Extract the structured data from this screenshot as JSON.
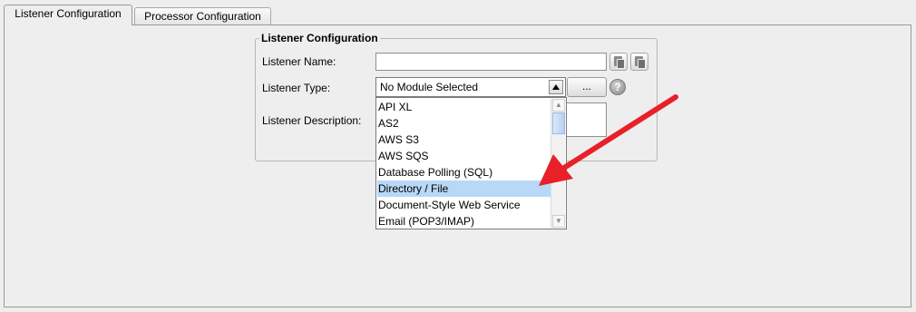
{
  "tabs": [
    {
      "label": "Listener Configuration",
      "active": true
    },
    {
      "label": "Processor Configuration",
      "active": false
    }
  ],
  "group": {
    "title": "Listener Configuration"
  },
  "form": {
    "name_label": "Listener Name:",
    "name_value": "",
    "type_label": "Listener Type:",
    "type_value": "No Module Selected",
    "description_label": "Listener Description:",
    "browse_button": "...",
    "help_icon": "?"
  },
  "dropdown": {
    "items": [
      "API XL",
      "AS2",
      "AWS S3",
      "AWS SQS",
      "Database Polling (SQL)",
      "Directory / File",
      "Document-Style Web Service",
      "Email (POP3/IMAP)"
    ],
    "selected": "Directory / File"
  },
  "icons": {
    "copy": "copy-icon",
    "paste": "paste-icon",
    "help": "help-icon",
    "dropdown_arrow": "chevron-up-icon",
    "scroll_up": "chevron-up-icon",
    "scroll_down": "chevron-down-icon",
    "annotation": "red-arrow-annotation"
  },
  "colors": {
    "background": "#eeeeee",
    "selection": "#b8d8f8",
    "annotation_arrow": "#e8202a"
  }
}
